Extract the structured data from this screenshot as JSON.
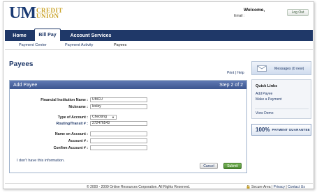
{
  "header": {
    "logo_um": "UM",
    "logo_line1": "CREDIT",
    "logo_line2": "UNION",
    "welcome": "Welcome,",
    "email_label": "Email :",
    "logout": "Log Out"
  },
  "nav": {
    "tabs": [
      {
        "label": "Home"
      },
      {
        "label": "Bill Pay"
      },
      {
        "label": "Account Services"
      }
    ],
    "sub": [
      {
        "label": "Payment Center"
      },
      {
        "label": "Payment Activity"
      },
      {
        "label": "Payees"
      }
    ]
  },
  "page": {
    "title": "Payees",
    "print": "Print",
    "sep": " | ",
    "help": "Help"
  },
  "panel": {
    "title": "Add Payee",
    "step": "Step 2 of 2",
    "fields": {
      "institution_label": "Financial Institution Name :",
      "institution_value": "UMCU",
      "nickname_label": "Nickname :",
      "nickname_value": "lesley",
      "type_label": "Type of Account :",
      "type_value": "Checking",
      "routing_label": "Routing/Transit # :",
      "routing_value": "272476543",
      "name_label": "Name on Account :",
      "account_label": "Account # :",
      "confirm_label": "Confirm Account # :"
    },
    "dont_have": "I don't have this information.",
    "cancel": "Cancel",
    "submit": "Submit"
  },
  "sidebar": {
    "messages": "Messages (0 new)",
    "quick_title": "Quick Links",
    "quick_links": [
      {
        "label": "Add Payee"
      },
      {
        "label": "Make a Payment"
      },
      {
        "label": "View Demo"
      }
    ],
    "guarantee_num": "100%",
    "guarantee_text": "PAYMENT GUARANTEE"
  },
  "footer": {
    "copyright": "© 2000 - 2009 Online Resources Corporation. All Rights Reserved.",
    "secure": "Secure Area",
    "privacy": "Privacy",
    "contact": "Contact Us"
  },
  "colors": {
    "brand_navy": "#1f3868",
    "brand_gold": "#c9a227",
    "submit_green": "#5a9a3e"
  }
}
